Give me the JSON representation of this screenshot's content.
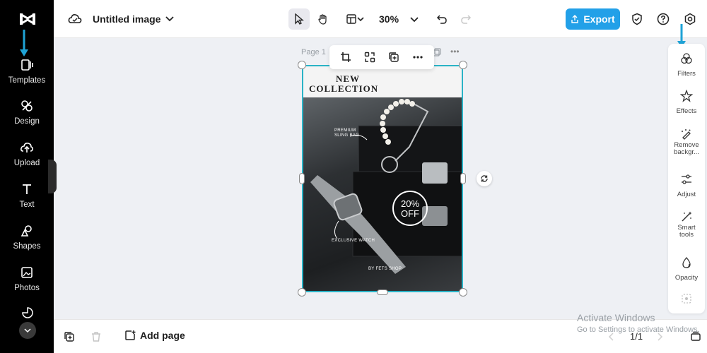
{
  "app": {
    "name": "CapCut"
  },
  "sidebar": {
    "items": [
      {
        "label": "Templates",
        "icon": "templates-icon"
      },
      {
        "label": "Design",
        "icon": "design-icon"
      },
      {
        "label": "Upload",
        "icon": "upload-icon"
      },
      {
        "label": "Text",
        "icon": "text-icon"
      },
      {
        "label": "Shapes",
        "icon": "shapes-icon"
      },
      {
        "label": "Photos",
        "icon": "photos-icon"
      }
    ]
  },
  "topbar": {
    "title": "Untitled image",
    "zoom": "30%",
    "export_label": "Export"
  },
  "canvas": {
    "page_label": "Page 1",
    "poster": {
      "title_line1": "NEW",
      "title_line2": "COLLECTION",
      "badge_line1": "20%",
      "badge_line2": "OFF",
      "label_bag_line1": "PREMIUM",
      "label_bag_line2": "SLING BAG",
      "label_watch": "EXCLUSIVE WATCH",
      "shop_name": "BY FETS SHOP"
    }
  },
  "right_panel": {
    "items": [
      {
        "label": "Filters",
        "icon": "filters-icon"
      },
      {
        "label": "Effects",
        "icon": "effects-icon"
      },
      {
        "label": "Remove backgr...",
        "icon": "remove-background-icon"
      },
      {
        "label": "Adjust",
        "icon": "adjust-icon"
      },
      {
        "label": "Smart tools",
        "icon": "smart-tools-icon"
      },
      {
        "label": "Opacity",
        "icon": "opacity-icon"
      }
    ]
  },
  "bottombar": {
    "add_page_label": "Add page",
    "page_count": "1/1"
  },
  "watermark": {
    "line1": "Activate Windows",
    "line2": "Go to Settings to activate Windows."
  },
  "colors": {
    "accent": "#22a0e8",
    "selection": "#2ab3c6",
    "sidebar_bg": "#000000"
  }
}
